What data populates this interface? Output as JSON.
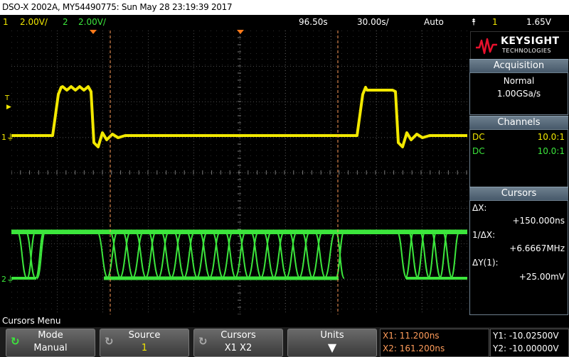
{
  "title_bar": "DSO-X 2002A, MY54490775: Sun May 28 23:19:39 2017",
  "status": {
    "ch1_num": "1",
    "ch1_scale": "2.00V/",
    "ch2_num": "2",
    "ch2_scale": "2.00V/",
    "delay": "96.50s",
    "timebase": "30.00s/",
    "trigger_mode": "Auto",
    "trigger_icon": "rising-edge-trigger-icon",
    "trigger_source": "1",
    "trigger_level": "1.65V"
  },
  "plot_markers": {
    "trigger_level_marker": "T",
    "ch1_marker": "1",
    "ch2_marker": "2"
  },
  "brand": {
    "name": "KEYSIGHT",
    "sub": "TECHNOLOGIES"
  },
  "acquisition": {
    "header": "Acquisition",
    "mode": "Normal",
    "rate": "1.00GSa/s"
  },
  "channels": {
    "header": "Channels",
    "rows": [
      {
        "coupling": "DC",
        "probe": "10.0:1",
        "color": "#f2e800"
      },
      {
        "coupling": "DC",
        "probe": "10.0:1",
        "color": "#3ce63c"
      }
    ]
  },
  "cursors": {
    "header": "Cursors",
    "dx_label": "ΔX:",
    "dx_value": "+150.000ns",
    "inv_dx_label": "1/ΔX:",
    "inv_dx_value": "+6.6667MHz",
    "dy_label": "ΔY(1):",
    "dy_value": "+25.00mV"
  },
  "menu_label": "Cursors Menu",
  "softkeys": [
    {
      "label": "Mode",
      "value": "Manual"
    },
    {
      "label": "Source",
      "value": "1"
    },
    {
      "label": "Cursors",
      "value": "X1 X2"
    },
    {
      "label": "Units",
      "value": ""
    }
  ],
  "cursor_readout": {
    "x1": "X1: 11.200ns",
    "x2": "X2: 161.200ns",
    "y1": "Y1: -10.02500V",
    "y2": "Y2: -10.00000V"
  },
  "colors": {
    "ch1": "#f2e800",
    "ch2": "#3ce63c",
    "cursor": "#ff9c5a",
    "grid": "#555555",
    "brand_red": "#e8112d"
  }
}
